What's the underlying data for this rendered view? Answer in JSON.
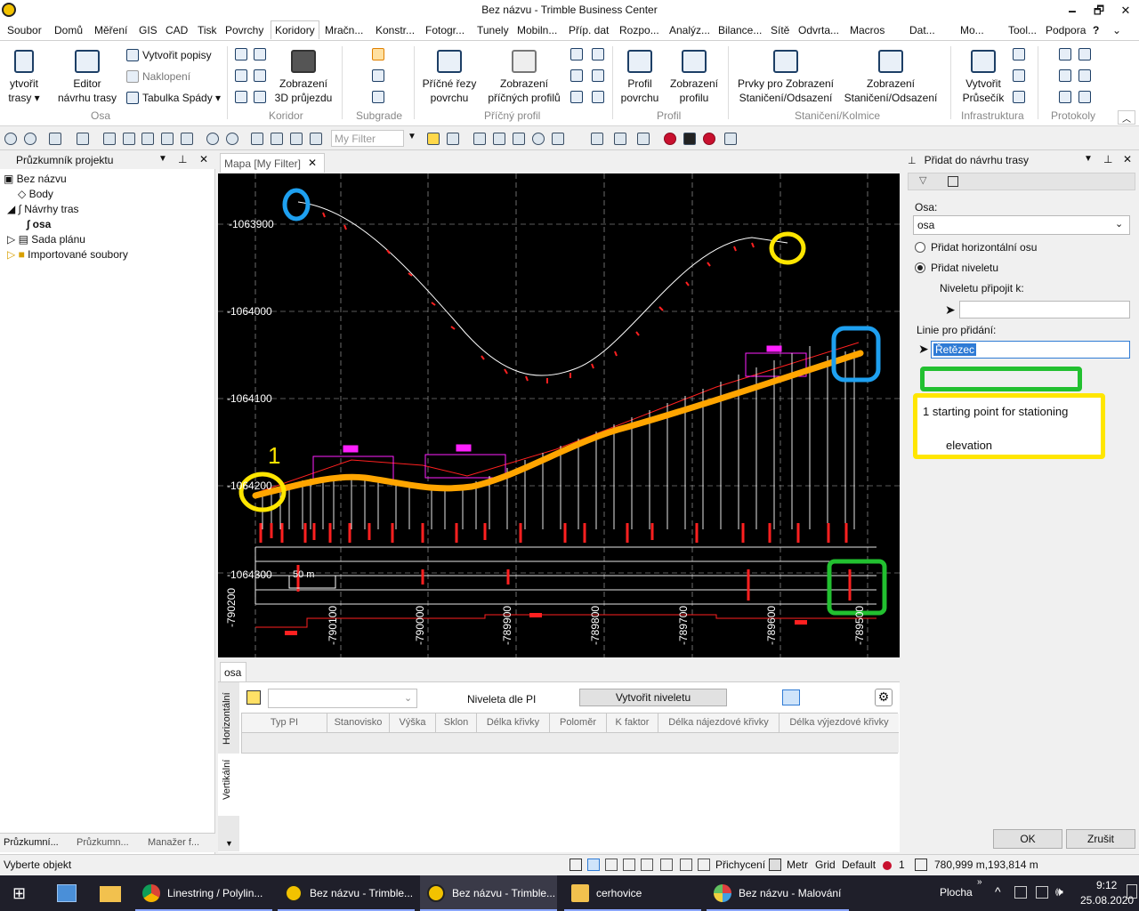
{
  "window": {
    "title": "Bez názvu - Trimble Business Center",
    "min": "🗕",
    "max": "🗗",
    "close": "✕"
  },
  "menu": [
    "Soubor",
    "Domů",
    "Měření",
    "GIS",
    "CAD",
    "Tisk",
    "Povrchy",
    "Koridory",
    "Mračn...",
    "Konstr...",
    "Fotogr...",
    "Tunely",
    "Mobiln...",
    "Příp. dat",
    "Rozpo...",
    "Analýz...",
    "Bilance...",
    "Sítě",
    "Odvrta...",
    "Macros",
    "Dat...",
    "Mo...",
    "Tool...",
    "Podpora"
  ],
  "menu_active": "Koridory",
  "ribbon": {
    "osa": {
      "b1": "ytvořit",
      "b1b": "trasy ▾",
      "b2": "Editor",
      "b2b": "návrhu trasy",
      "s1": "Vytvořit popisy",
      "s2": "Naklopení",
      "s3": "Tabulka Spády ▾",
      "group": "Osa"
    },
    "koridor": {
      "b1": "Zobrazení",
      "b1b": "3D průjezdu",
      "group": "Koridor"
    },
    "subgrade": {
      "group": "Subgrade"
    },
    "pricny": {
      "b1": "Příčné řezy",
      "b1b": "povrchu",
      "b2": "Zobrazení",
      "b2b": "příčných profilů",
      "group": "Příčný profil"
    },
    "profil": {
      "b1": "Profil",
      "b1b": "povrchu",
      "b2": "Zobrazení",
      "b2b": "profilu",
      "group": "Profil"
    },
    "staniceni": {
      "b1": "Prvky pro Zobrazení",
      "b1b": "Staničení/Odsazení",
      "b2": "Zobrazení",
      "b2b": "Staničení/Odsazení",
      "group": "Staničení/Kolmice"
    },
    "infra": {
      "b1": "Vytvořit",
      "b1b": "Průsečík",
      "group": "Infrastruktura"
    },
    "protokoly": {
      "group": "Protokoly"
    }
  },
  "toolbar": {
    "filter_placeholder": "My Filter"
  },
  "explorer": {
    "title": "Průzkumník projektu",
    "items": [
      {
        "label": "Bez názvu"
      },
      {
        "label": "Body"
      },
      {
        "label": "Návrhy tras"
      },
      {
        "label": "osa"
      },
      {
        "label": "Sada plánu"
      },
      {
        "label": "Importované soubory"
      }
    ],
    "tabs": [
      "Průzkumní...",
      "Průzkumn...",
      "Manažer f..."
    ]
  },
  "map": {
    "tab": "Mapa [My Filter]",
    "y_labels": [
      "-1063900",
      "-1064000",
      "-1064100",
      "-1064200",
      "-1064300"
    ],
    "x_labels": [
      "-790200",
      "-790100",
      "-790000",
      "-789900",
      "-789800",
      "-789700",
      "-789600",
      "-789500"
    ],
    "scale_label": "50 m",
    "annotation_1": "1"
  },
  "right_panel": {
    "title": "Přidat do návrhu trasy",
    "osa_label": "Osa:",
    "osa_value": "osa",
    "radio1": "Přidat horizontální osu",
    "radio2": "Přidat niveletu",
    "attach_label": "Niveletu připojit k:",
    "line_label": "Linie pro přidání:",
    "line_value": "Řetězec",
    "note_line1": "1  starting point for stationing",
    "note_line2": "elevation",
    "ok": "OK",
    "cancel": "Zrušit"
  },
  "bottom_panel": {
    "tab": "osa",
    "vtabs": [
      "Horizontální",
      "Vertikální"
    ],
    "title": "Niveleta dle PI",
    "create_button": "Vytvořit niveletu",
    "columns": [
      "Typ PI",
      "Stanovisko",
      "Výška",
      "Sklon",
      "Délka křivky",
      "Poloměr",
      "K faktor",
      "Délka nájezdové křivky",
      "Délka výjezdové křivky"
    ]
  },
  "status": {
    "left": "Vyberte objekt",
    "prichyceni": "Přichycení",
    "metr": "Metr",
    "grid": "Grid",
    "default": "Default",
    "count": "1",
    "coords": "780,999 m,193,814 m"
  },
  "taskbar": {
    "items": [
      "Linestring / Polylin...",
      "Bez názvu - Trimble...",
      "Bez názvu - Trimble...",
      "cerhovice",
      "Bez názvu - Malování"
    ],
    "plocha": "Plocha",
    "time": "9:12",
    "date": "25.08.2020"
  },
  "colors": {
    "map_bg": "#000000",
    "alignment": "#ffffff",
    "profile": "#ffa500",
    "annot_yellow": "#ffe600",
    "annot_blue": "#1ea0f0",
    "annot_green": "#22c030"
  }
}
